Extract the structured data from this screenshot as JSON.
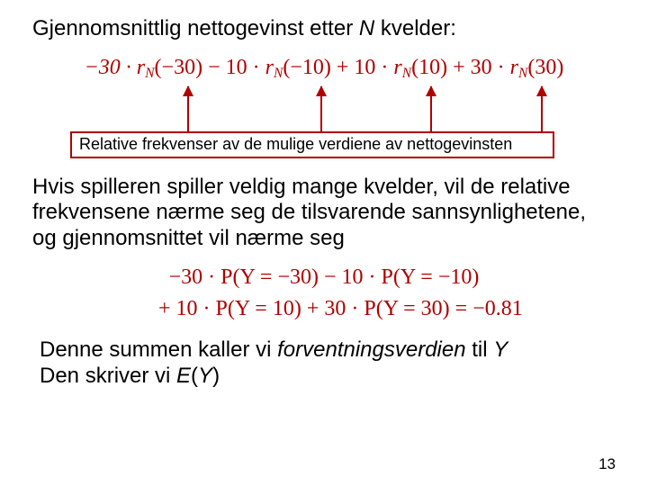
{
  "title": {
    "pre": "Gjennomsnittlig nettogevinst etter ",
    "var": "N",
    "post": "  kvelder:"
  },
  "formula1": {
    "t1": "−30 · ",
    "r": "r",
    "n": "N",
    "a1": "(−30) − 10 · ",
    "a2": "(−10) + 10 · ",
    "a3": "(10) + 30 · ",
    "a4": "(30)"
  },
  "caption": "Relative frekvenser av de mulige verdiene av nettogevinsten",
  "para2": "Hvis spilleren spiller veldig mange kvelder, vil de relative frekvensene nærme seg de tilsvarende sannsynlighetene, og gjennomsnittet vil nærme seg",
  "formula2a": "−30 · P(Y = −30) − 10 · P(Y = −10)",
  "formula2b": "+ 10 · P(Y = 10) + 30 · P(Y = 30) = −0.81",
  "para3": {
    "l1a": "Denne summen kaller vi ",
    "l1b": "forventningsverdien",
    "l1c": "  til ",
    "l1d": "Y",
    "l2a": "Den skriver vi ",
    "l2b": "E",
    "l2c": "(",
    "l2d": "Y",
    "l2e": ")"
  },
  "page": "13"
}
